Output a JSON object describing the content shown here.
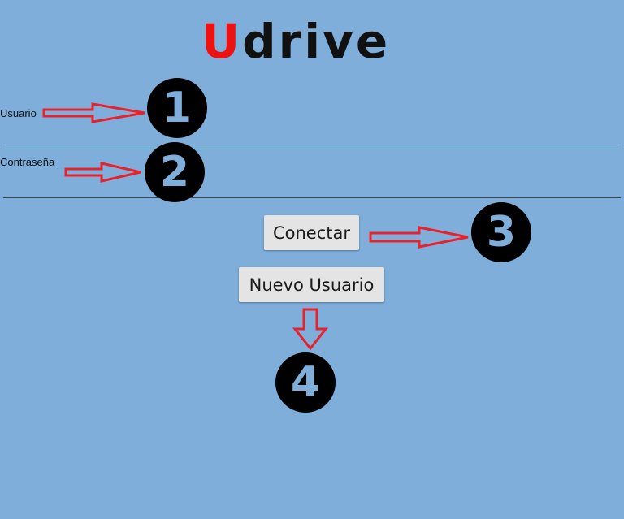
{
  "logo": {
    "first_letter": "U",
    "rest": "drive",
    "first_letter_color": "#ee1111",
    "rest_color": "#111111"
  },
  "form": {
    "username_label": "Usuario",
    "username_value": "",
    "password_label": "Contraseña",
    "password_value": "",
    "username_underline_color": "#2a8a8a",
    "password_underline_color": "#444444"
  },
  "buttons": {
    "connect_label": "Conectar",
    "new_user_label": "Nuevo Usuario"
  },
  "annotations": {
    "badge_1": "1",
    "badge_2": "2",
    "badge_3": "3",
    "badge_4": "4",
    "arrow_color": "#e8212a",
    "badge_color": "#000000"
  },
  "colors": {
    "background": "#7faedb"
  }
}
